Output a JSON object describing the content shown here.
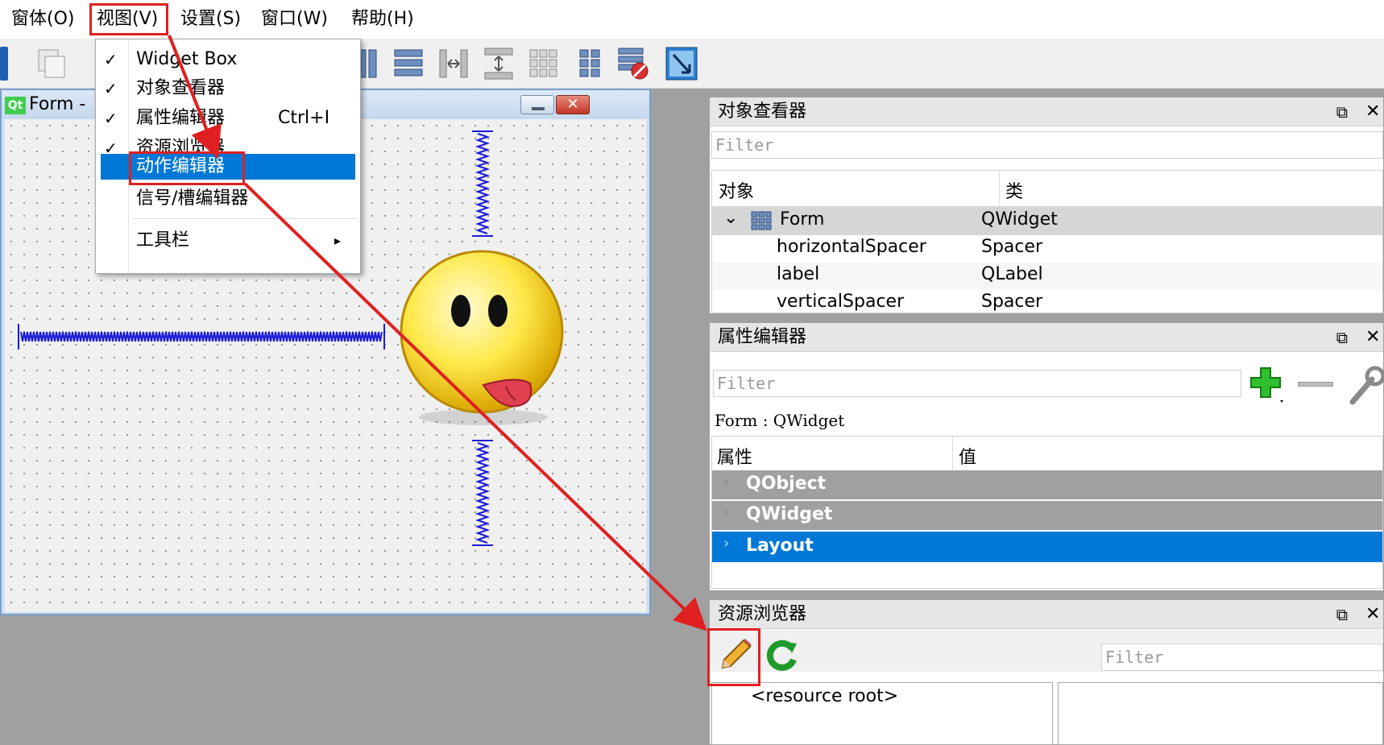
{
  "menubar": {
    "items": [
      "窗体(O)",
      "视图(V)",
      "设置(S)",
      "窗口(W)",
      "帮助(H)"
    ]
  },
  "view_menu": {
    "items": [
      {
        "label": "Widget Box",
        "checked": true,
        "shortcut": ""
      },
      {
        "label": "对象查看器",
        "checked": true,
        "shortcut": ""
      },
      {
        "label": "属性编辑器",
        "checked": true,
        "shortcut": "Ctrl+I"
      },
      {
        "label": "资源浏览器",
        "checked": true,
        "shortcut": ""
      },
      {
        "label": "动作编辑器",
        "checked": false,
        "shortcut": "",
        "highlighted": true
      },
      {
        "label": "信号/槽编辑器",
        "checked": false,
        "shortcut": ""
      },
      {
        "label": "工具栏",
        "checked": false,
        "shortcut": "",
        "submenu": true
      }
    ],
    "check_glyph": "✓",
    "submenu_glyph": "▸"
  },
  "form_window": {
    "badge": "Qt",
    "title": "Form -"
  },
  "object_inspector": {
    "title": "对象查看器",
    "filter_placeholder": "Filter",
    "col_object": "对象",
    "col_class": "类",
    "rows": [
      {
        "object": "Form",
        "class": "QWidget"
      },
      {
        "object": "horizontalSpacer",
        "class": "Spacer"
      },
      {
        "object": "label",
        "class": "QLabel"
      },
      {
        "object": "verticalSpacer",
        "class": "Spacer"
      }
    ],
    "expand_glyph": "⌄"
  },
  "property_editor": {
    "title": "属性编辑器",
    "filter_placeholder": "Filter",
    "context": "Form : QWidget",
    "col_property": "属性",
    "col_value": "值",
    "groups": [
      "QObject",
      "QWidget",
      "Layout"
    ]
  },
  "resource_browser": {
    "title": "资源浏览器",
    "filter_placeholder": "Filter",
    "root": "<resource root>"
  },
  "dock_buttons": {
    "float": "⧉",
    "close": "✕"
  },
  "colors": {
    "accent": "#0078d7",
    "annotation_red": "#e02020",
    "group_gray": "#a0a0a0",
    "spacer_blue": "#1b1bd6",
    "add_green": "#2fbf2f"
  }
}
